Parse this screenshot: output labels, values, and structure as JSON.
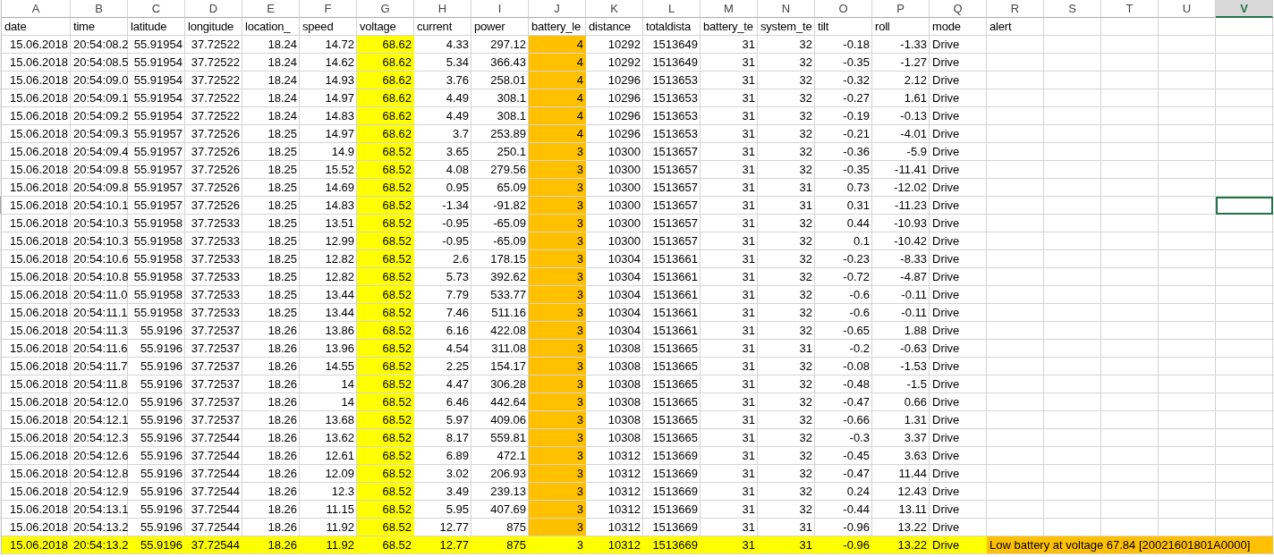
{
  "columns": [
    {
      "letter": "A",
      "header": "date",
      "kind": "number",
      "selected": false
    },
    {
      "letter": "B",
      "header": "time",
      "kind": "text",
      "selected": false
    },
    {
      "letter": "C",
      "header": "latitude",
      "kind": "number",
      "selected": false
    },
    {
      "letter": "D",
      "header": "longitude",
      "kind": "number",
      "selected": false
    },
    {
      "letter": "E",
      "header": "location_",
      "kind": "number",
      "selected": false
    },
    {
      "letter": "F",
      "header": "speed",
      "kind": "number",
      "selected": false
    },
    {
      "letter": "G",
      "header": "voltage",
      "kind": "number",
      "selected": false,
      "color": "#ffff00"
    },
    {
      "letter": "H",
      "header": "current",
      "kind": "number",
      "selected": false
    },
    {
      "letter": "I",
      "header": "power",
      "kind": "number",
      "selected": false
    },
    {
      "letter": "J",
      "header": "battery_le",
      "kind": "number",
      "selected": false,
      "color": "#ffc000"
    },
    {
      "letter": "K",
      "header": "distance",
      "kind": "number",
      "selected": false
    },
    {
      "letter": "L",
      "header": "totaldista",
      "kind": "number",
      "selected": false
    },
    {
      "letter": "M",
      "header": "battery_te",
      "kind": "number",
      "selected": false
    },
    {
      "letter": "N",
      "header": "system_te",
      "kind": "number",
      "selected": false
    },
    {
      "letter": "O",
      "header": "tilt",
      "kind": "number",
      "selected": false
    },
    {
      "letter": "P",
      "header": "roll",
      "kind": "number",
      "selected": false
    },
    {
      "letter": "Q",
      "header": "mode",
      "kind": "text",
      "selected": false
    },
    {
      "letter": "R",
      "header": "alert",
      "kind": "text",
      "selected": false
    },
    {
      "letter": "S",
      "selected": false
    },
    {
      "letter": "T",
      "selected": false
    },
    {
      "letter": "U",
      "selected": false
    },
    {
      "letter": "V",
      "selected": true
    }
  ],
  "rows": [
    {
      "cells": [
        "15.06.2018",
        "20:54:08.2",
        "55.91954",
        "37.72522",
        "18.24",
        "14.72",
        "68.62",
        "4.33",
        "297.12",
        "4",
        "10292",
        "1513649",
        "31",
        "32",
        "-0.18",
        "-1.33",
        "Drive"
      ],
      "highlighted": false,
      "selected": false
    },
    {
      "cells": [
        "15.06.2018",
        "20:54:08.5",
        "55.91954",
        "37.72522",
        "18.24",
        "14.62",
        "68.62",
        "5.34",
        "366.43",
        "4",
        "10292",
        "1513649",
        "31",
        "32",
        "-0.35",
        "-1.27",
        "Drive"
      ],
      "highlighted": false,
      "selected": false
    },
    {
      "cells": [
        "15.06.2018",
        "20:54:09.0",
        "55.91954",
        "37.72522",
        "18.24",
        "14.93",
        "68.62",
        "3.76",
        "258.01",
        "4",
        "10296",
        "1513653",
        "31",
        "32",
        "-0.32",
        "2.12",
        "Drive"
      ],
      "highlighted": false,
      "selected": false
    },
    {
      "cells": [
        "15.06.2018",
        "20:54:09.1",
        "55.91954",
        "37.72522",
        "18.24",
        "14.97",
        "68.62",
        "4.49",
        "308.1",
        "4",
        "10296",
        "1513653",
        "31",
        "32",
        "-0.27",
        "1.61",
        "Drive"
      ],
      "highlighted": false,
      "selected": false
    },
    {
      "cells": [
        "15.06.2018",
        "20:54:09.2",
        "55.91954",
        "37.72522",
        "18.24",
        "14.83",
        "68.62",
        "4.49",
        "308.1",
        "4",
        "10296",
        "1513653",
        "31",
        "32",
        "-0.19",
        "-0.13",
        "Drive"
      ],
      "highlighted": false,
      "selected": false
    },
    {
      "cells": [
        "15.06.2018",
        "20:54:09.3",
        "55.91957",
        "37.72526",
        "18.25",
        "14.97",
        "68.62",
        "3.7",
        "253.89",
        "4",
        "10296",
        "1513653",
        "31",
        "32",
        "-0.21",
        "-4.01",
        "Drive"
      ],
      "highlighted": false,
      "selected": false
    },
    {
      "cells": [
        "15.06.2018",
        "20:54:09.4",
        "55.91957",
        "37.72526",
        "18.25",
        "14.9",
        "68.52",
        "3.65",
        "250.1",
        "3",
        "10300",
        "1513657",
        "31",
        "32",
        "-0.36",
        "-5.9",
        "Drive"
      ],
      "highlighted": false,
      "selected": false
    },
    {
      "cells": [
        "15.06.2018",
        "20:54:09.8",
        "55.91957",
        "37.72526",
        "18.25",
        "15.52",
        "68.52",
        "4.08",
        "279.56",
        "3",
        "10300",
        "1513657",
        "31",
        "32",
        "-0.35",
        "-11.41",
        "Drive"
      ],
      "highlighted": false,
      "selected": false
    },
    {
      "cells": [
        "15.06.2018",
        "20:54:09.8",
        "55.91957",
        "37.72526",
        "18.25",
        "14.69",
        "68.52",
        "0.95",
        "65.09",
        "3",
        "10300",
        "1513657",
        "31",
        "31",
        "0.73",
        "-12.02",
        "Drive"
      ],
      "highlighted": false,
      "selected": false
    },
    {
      "cells": [
        "15.06.2018",
        "20:54:10.1",
        "55.91957",
        "37.72526",
        "18.25",
        "14.83",
        "68.52",
        "-1.34",
        "-91.82",
        "3",
        "10300",
        "1513657",
        "31",
        "31",
        "0.31",
        "-11.23",
        "Drive"
      ],
      "highlighted": false,
      "selected": true
    },
    {
      "cells": [
        "15.06.2018",
        "20:54:10.3",
        "55.91958",
        "37.72533",
        "18.25",
        "13.51",
        "68.52",
        "-0.95",
        "-65.09",
        "3",
        "10300",
        "1513657",
        "31",
        "32",
        "0.44",
        "-10.93",
        "Drive"
      ],
      "highlighted": false,
      "selected": false
    },
    {
      "cells": [
        "15.06.2018",
        "20:54:10.3",
        "55.91958",
        "37.72533",
        "18.25",
        "12.99",
        "68.52",
        "-0.95",
        "-65.09",
        "3",
        "10300",
        "1513657",
        "31",
        "32",
        "0.1",
        "-10.42",
        "Drive"
      ],
      "highlighted": false,
      "selected": false
    },
    {
      "cells": [
        "15.06.2018",
        "20:54:10.6",
        "55.91958",
        "37.72533",
        "18.25",
        "12.82",
        "68.52",
        "2.6",
        "178.15",
        "3",
        "10304",
        "1513661",
        "31",
        "32",
        "-0.23",
        "-8.33",
        "Drive"
      ],
      "highlighted": false,
      "selected": false
    },
    {
      "cells": [
        "15.06.2018",
        "20:54:10.8",
        "55.91958",
        "37.72533",
        "18.25",
        "12.82",
        "68.52",
        "5.73",
        "392.62",
        "3",
        "10304",
        "1513661",
        "31",
        "32",
        "-0.72",
        "-4.87",
        "Drive"
      ],
      "highlighted": false,
      "selected": false
    },
    {
      "cells": [
        "15.06.2018",
        "20:54:11.0",
        "55.91958",
        "37.72533",
        "18.25",
        "13.44",
        "68.52",
        "7.79",
        "533.77",
        "3",
        "10304",
        "1513661",
        "31",
        "32",
        "-0.6",
        "-0.11",
        "Drive"
      ],
      "highlighted": false,
      "selected": false
    },
    {
      "cells": [
        "15.06.2018",
        "20:54:11.1",
        "55.91958",
        "37.72533",
        "18.25",
        "13.44",
        "68.52",
        "7.46",
        "511.16",
        "3",
        "10304",
        "1513661",
        "31",
        "32",
        "-0.6",
        "-0.11",
        "Drive"
      ],
      "highlighted": false,
      "selected": false
    },
    {
      "cells": [
        "15.06.2018",
        "20:54:11.3",
        "55.9196",
        "37.72537",
        "18.26",
        "13.86",
        "68.52",
        "6.16",
        "422.08",
        "3",
        "10304",
        "1513661",
        "31",
        "32",
        "-0.65",
        "1.88",
        "Drive"
      ],
      "highlighted": false,
      "selected": false
    },
    {
      "cells": [
        "15.06.2018",
        "20:54:11.6",
        "55.9196",
        "37.72537",
        "18.26",
        "13.96",
        "68.52",
        "4.54",
        "311.08",
        "3",
        "10308",
        "1513665",
        "31",
        "31",
        "-0.2",
        "-0.63",
        "Drive"
      ],
      "highlighted": false,
      "selected": false
    },
    {
      "cells": [
        "15.06.2018",
        "20:54:11.7",
        "55.9196",
        "37.72537",
        "18.26",
        "14.55",
        "68.52",
        "2.25",
        "154.17",
        "3",
        "10308",
        "1513665",
        "31",
        "32",
        "-0.08",
        "-1.53",
        "Drive"
      ],
      "highlighted": false,
      "selected": false
    },
    {
      "cells": [
        "15.06.2018",
        "20:54:11.8",
        "55.9196",
        "37.72537",
        "18.26",
        "14",
        "68.52",
        "4.47",
        "306.28",
        "3",
        "10308",
        "1513665",
        "31",
        "32",
        "-0.48",
        "-1.5",
        "Drive"
      ],
      "highlighted": false,
      "selected": false
    },
    {
      "cells": [
        "15.06.2018",
        "20:54:12.0",
        "55.9196",
        "37.72537",
        "18.26",
        "14",
        "68.52",
        "6.46",
        "442.64",
        "3",
        "10308",
        "1513665",
        "31",
        "32",
        "-0.47",
        "0.66",
        "Drive"
      ],
      "highlighted": false,
      "selected": false
    },
    {
      "cells": [
        "15.06.2018",
        "20:54:12.1",
        "55.9196",
        "37.72537",
        "18.26",
        "13.68",
        "68.52",
        "5.97",
        "409.06",
        "3",
        "10308",
        "1513665",
        "31",
        "32",
        "-0.66",
        "1.31",
        "Drive"
      ],
      "highlighted": false,
      "selected": false
    },
    {
      "cells": [
        "15.06.2018",
        "20:54:12.3",
        "55.9196",
        "37.72544",
        "18.26",
        "13.62",
        "68.52",
        "8.17",
        "559.81",
        "3",
        "10308",
        "1513665",
        "31",
        "32",
        "-0.3",
        "3.37",
        "Drive"
      ],
      "highlighted": false,
      "selected": false
    },
    {
      "cells": [
        "15.06.2018",
        "20:54:12.6",
        "55.9196",
        "37.72544",
        "18.26",
        "12.61",
        "68.52",
        "6.89",
        "472.1",
        "3",
        "10312",
        "1513669",
        "31",
        "32",
        "-0.45",
        "3.63",
        "Drive"
      ],
      "highlighted": false,
      "selected": false
    },
    {
      "cells": [
        "15.06.2018",
        "20:54:12.8",
        "55.9196",
        "37.72544",
        "18.26",
        "12.09",
        "68.52",
        "3.02",
        "206.93",
        "3",
        "10312",
        "1513669",
        "31",
        "32",
        "-0.47",
        "11.44",
        "Drive"
      ],
      "highlighted": false,
      "selected": false
    },
    {
      "cells": [
        "15.06.2018",
        "20:54:12.9",
        "55.9196",
        "37.72544",
        "18.26",
        "12.3",
        "68.52",
        "3.49",
        "239.13",
        "3",
        "10312",
        "1513669",
        "31",
        "32",
        "0.24",
        "12.43",
        "Drive"
      ],
      "highlighted": false,
      "selected": false
    },
    {
      "cells": [
        "15.06.2018",
        "20:54:13.1",
        "55.9196",
        "37.72544",
        "18.26",
        "11.15",
        "68.52",
        "5.95",
        "407.69",
        "3",
        "10312",
        "1513669",
        "31",
        "32",
        "-0.44",
        "13.11",
        "Drive"
      ],
      "highlighted": false,
      "selected": false
    },
    {
      "cells": [
        "15.06.2018",
        "20:54:13.2",
        "55.9196",
        "37.72544",
        "18.26",
        "11.92",
        "68.52",
        "12.77",
        "875",
        "3",
        "10312",
        "1513669",
        "31",
        "31",
        "-0.96",
        "13.22",
        "Drive"
      ],
      "highlighted": false,
      "selected": false
    },
    {
      "cells": [
        "15.06.2018",
        "20:54:13.2",
        "55.9196",
        "37.72544",
        "18.26",
        "11.92",
        "68.52",
        "12.77",
        "875",
        "3",
        "10312",
        "1513669",
        "31",
        "31",
        "-0.96",
        "13.22",
        "Drive"
      ],
      "highlighted": true,
      "selected": false,
      "alert": "Low battery at voltage 67.84 [20021601801A0000]"
    }
  ]
}
